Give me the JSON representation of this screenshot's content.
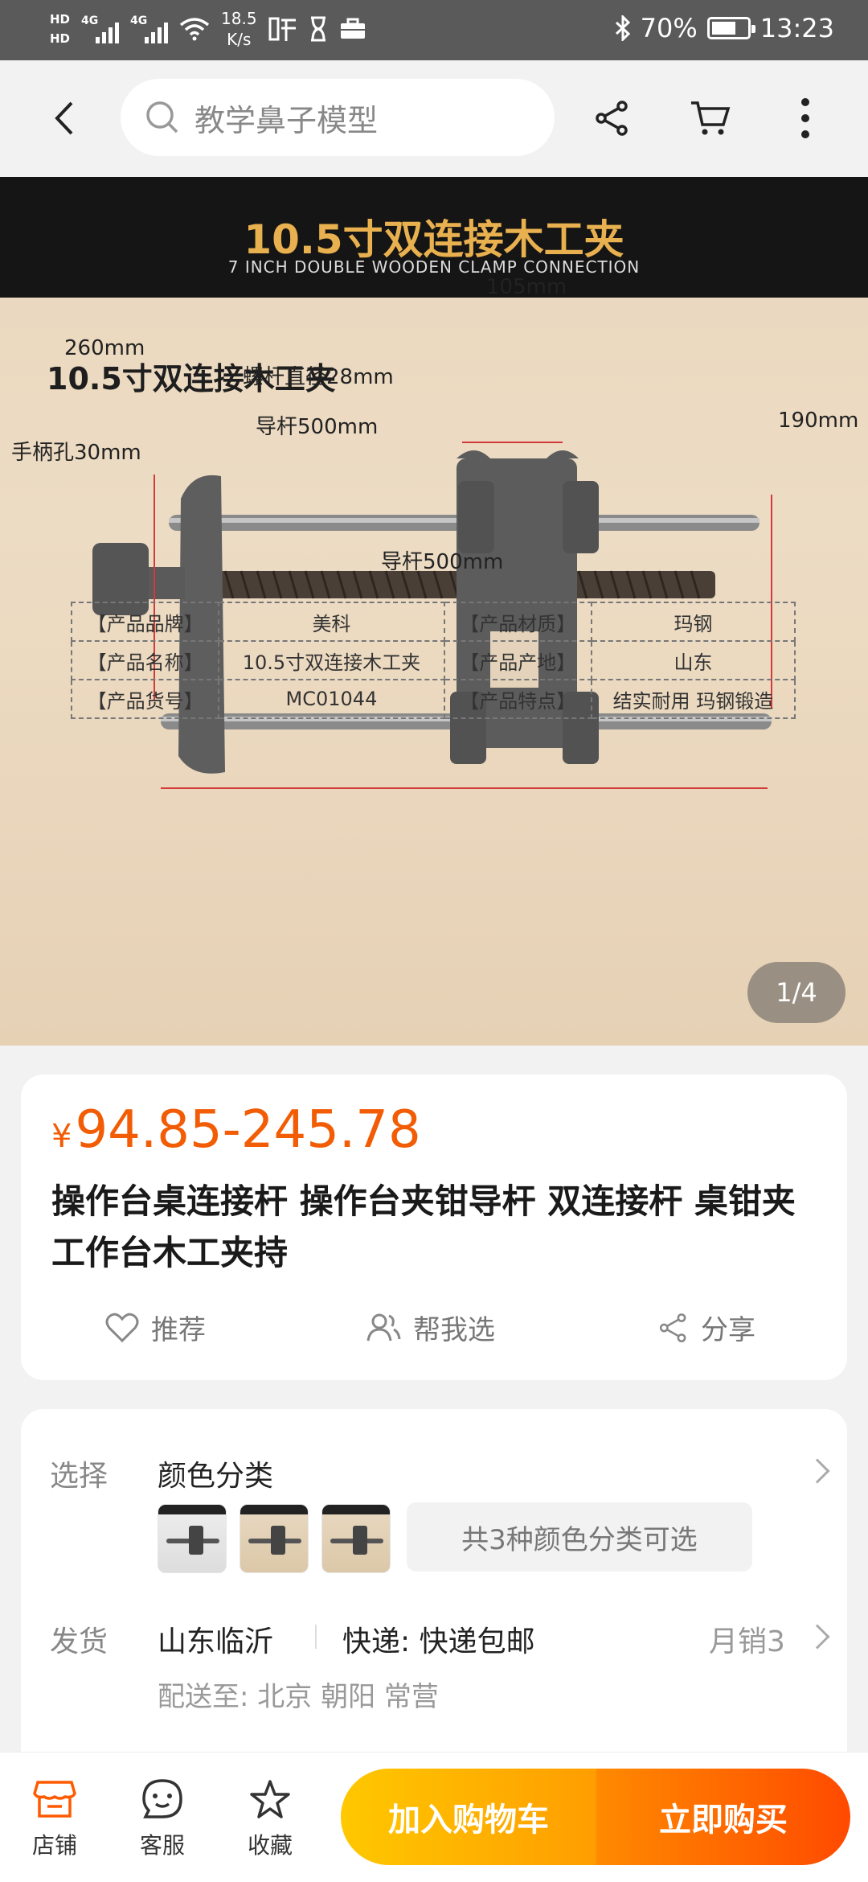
{
  "status_bar": {
    "hd1": "HD",
    "hd2": "HD",
    "net1": "4G",
    "net2": "4G",
    "speed_value": "18.5",
    "speed_unit": "K/s",
    "battery": "70%",
    "battery_level": 0.7,
    "time": "13:23"
  },
  "nav": {
    "search_placeholder": "教学鼻子模型"
  },
  "hero": {
    "banner_title": "10.5寸双连接木工夹",
    "banner_subtitle": "7 INCH DOUBLE WOODEN CLAMP CONNECTION",
    "heading": "10.5寸双连接木工夹",
    "dims": {
      "top": "105mm",
      "left": "260mm",
      "screw": "螺杆直径28mm",
      "guide_mid": "导杆500mm",
      "right": "190mm",
      "handle": "手柄孔30mm",
      "guide_bottom": "导杆500mm"
    },
    "spec_rows": [
      [
        "【产品品牌】",
        "美科",
        "【产品材质】",
        "玛钢"
      ],
      [
        "【产品名称】",
        "10.5寸双连接木工夹",
        "【产品产地】",
        "山东"
      ],
      [
        "【产品货号】",
        "MC01044",
        "【产品特点】",
        "结实耐用 玛钢锻造"
      ]
    ],
    "pager": "1/4"
  },
  "product": {
    "currency": "¥",
    "price": "94.85-245.78",
    "title": "操作台桌连接杆 操作台夹钳导杆 双连接杆 桌钳夹 工作台木工夹持",
    "actions": {
      "recommend": "推荐",
      "help_choose": "帮我选",
      "share": "分享"
    }
  },
  "options": {
    "select_label": "选择",
    "select_value": "颜色分类",
    "option_summary": "共3种颜色分类可选",
    "ship_label": "发货",
    "origin": "山东临沂",
    "express": "快递: 快递包邮",
    "monthly_sales": "月销3",
    "deliver_to": "配送至: 北京 朝阳 常营"
  },
  "bottom_bar": {
    "shop": "店铺",
    "service": "客服",
    "favorite": "收藏",
    "add_cart": "加入购物车",
    "buy_now": "立即购买"
  },
  "colors": {
    "accent": "#f25c05",
    "cart_btn": "#ffb300",
    "buy_btn": "#ff5a00"
  }
}
